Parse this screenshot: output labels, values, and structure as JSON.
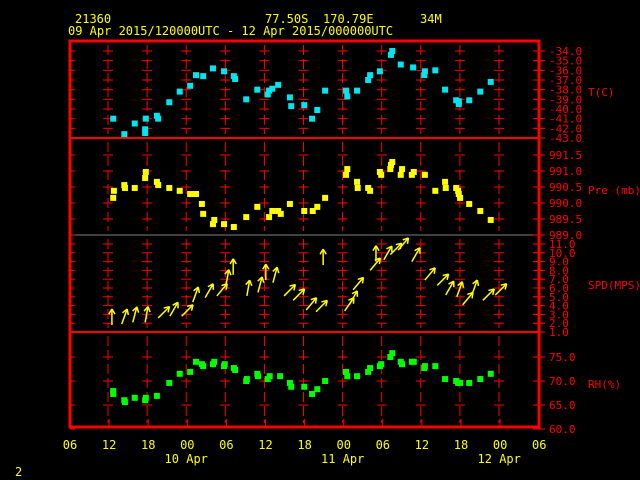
{
  "header": {
    "station": "21360",
    "lat": "77.50S",
    "lon": "170.79E",
    "elev": "34M",
    "period": "09 Apr 2015/120000UTC - 12 Apr 2015/000000UTC"
  },
  "page_number": "2",
  "colors": {
    "frame": "#ff0000",
    "temp": "#00e5ee",
    "pres": "#ffff00",
    "wind": "#ffff00",
    "rh": "#00ff00",
    "text": "#ffff00"
  },
  "chart_data": {
    "type": "scatter",
    "x_unit": "hours since 09 Apr 2015 12 UTC",
    "xlim": [
      -6,
      66
    ],
    "x_tick_labels": [
      "06",
      "12",
      "18",
      "00",
      "06",
      "12",
      "18",
      "00",
      "06",
      "12",
      "18",
      "00",
      "06"
    ],
    "date_labels": [
      {
        "label": "10 Apr",
        "hour": 12
      },
      {
        "label": "11 Apr",
        "hour": 36
      },
      {
        "label": "12 Apr",
        "hour": 60
      }
    ],
    "panels": [
      {
        "key": "temp",
        "label": "T(C)",
        "ylim": [
          -43,
          -34
        ],
        "ticks": [
          "-34.0",
          "-35.0",
          "-36.0",
          "-37.0",
          "-38.0",
          "-39.0",
          "-40.0",
          "-41.0",
          "-42.0",
          "-43.0"
        ],
        "points": [
          [
            0.8,
            -41.0
          ],
          [
            2.5,
            -42.6
          ],
          [
            4.1,
            -41.5
          ],
          [
            5.8,
            -41.0
          ],
          [
            5.7,
            -42.1
          ],
          [
            5.7,
            -42.5
          ],
          [
            7.5,
            -40.7
          ],
          [
            7.7,
            -41.0
          ],
          [
            9.4,
            -39.3
          ],
          [
            11.0,
            -38.2
          ],
          [
            12.6,
            -37.6
          ],
          [
            13.5,
            -36.5
          ],
          [
            14.6,
            -36.6
          ],
          [
            16.1,
            -35.8
          ],
          [
            17.8,
            -36.1
          ],
          [
            19.3,
            -36.6
          ],
          [
            19.5,
            -36.9
          ],
          [
            21.2,
            -39.0
          ],
          [
            22.9,
            -38.0
          ],
          [
            24.5,
            -38.5
          ],
          [
            24.7,
            -38.1
          ],
          [
            25.2,
            -37.9
          ],
          [
            26.1,
            -37.5
          ],
          [
            27.9,
            -38.8
          ],
          [
            28.1,
            -39.7
          ],
          [
            30.1,
            -39.6
          ],
          [
            31.3,
            -41.0
          ],
          [
            32.1,
            -40.1
          ],
          [
            33.3,
            -38.1
          ],
          [
            36.5,
            -38.1
          ],
          [
            36.7,
            -38.7
          ],
          [
            38.2,
            -38.1
          ],
          [
            39.9,
            -37.0
          ],
          [
            40.2,
            -36.5
          ],
          [
            41.7,
            -36.1
          ],
          [
            43.4,
            -34.4
          ],
          [
            43.6,
            -34.0
          ],
          [
            44.9,
            -35.4
          ],
          [
            46.8,
            -35.7
          ],
          [
            48.5,
            -36.5
          ],
          [
            48.6,
            -36.1
          ],
          [
            50.2,
            -36.0
          ],
          [
            51.7,
            -38.0
          ],
          [
            53.4,
            -39.1
          ],
          [
            53.8,
            -39.2
          ],
          [
            53.8,
            -39.5
          ],
          [
            55.4,
            -39.1
          ],
          [
            57.1,
            -38.2
          ],
          [
            58.7,
            -37.2
          ]
        ]
      },
      {
        "key": "pres",
        "label": "Pre (mb)",
        "ylim": [
          989.0,
          991.5
        ],
        "ticks": [
          "991.5",
          "991.0",
          "990.5",
          "990.0",
          "989.5",
          "989.0"
        ],
        "points": [
          [
            0.9,
            990.38
          ],
          [
            0.8,
            990.16
          ],
          [
            2.5,
            990.56
          ],
          [
            2.6,
            990.47
          ],
          [
            4.1,
            990.47
          ],
          [
            5.8,
            990.97
          ],
          [
            5.7,
            990.78
          ],
          [
            7.5,
            990.66
          ],
          [
            7.7,
            990.56
          ],
          [
            9.4,
            990.47
          ],
          [
            11.0,
            990.38
          ],
          [
            12.6,
            990.28
          ],
          [
            13.5,
            990.28
          ],
          [
            14.4,
            989.97
          ],
          [
            14.6,
            989.66
          ],
          [
            16.3,
            989.47
          ],
          [
            16.1,
            989.34
          ],
          [
            17.8,
            989.34
          ],
          [
            19.3,
            989.25
          ],
          [
            21.2,
            989.56
          ],
          [
            22.9,
            989.88
          ],
          [
            24.7,
            989.56
          ],
          [
            25.2,
            989.75
          ],
          [
            26.1,
            989.75
          ],
          [
            26.5,
            989.66
          ],
          [
            27.9,
            989.97
          ],
          [
            30.1,
            989.75
          ],
          [
            31.4,
            989.75
          ],
          [
            32.1,
            989.88
          ],
          [
            33.3,
            990.16
          ],
          [
            36.7,
            991.06
          ],
          [
            36.5,
            990.88
          ],
          [
            38.2,
            990.66
          ],
          [
            38.3,
            990.47
          ],
          [
            39.9,
            990.47
          ],
          [
            40.2,
            990.38
          ],
          [
            41.7,
            990.97
          ],
          [
            41.9,
            990.88
          ],
          [
            43.3,
            991.06
          ],
          [
            43.4,
            991.19
          ],
          [
            43.6,
            991.28
          ],
          [
            45.1,
            991.06
          ],
          [
            44.9,
            990.88
          ],
          [
            46.6,
            990.88
          ],
          [
            46.9,
            990.97
          ],
          [
            48.6,
            990.88
          ],
          [
            50.2,
            990.38
          ],
          [
            51.7,
            990.66
          ],
          [
            51.8,
            990.47
          ],
          [
            53.4,
            990.47
          ],
          [
            53.7,
            990.38
          ],
          [
            53.8,
            990.28
          ],
          [
            54.0,
            990.16
          ],
          [
            55.4,
            989.97
          ],
          [
            57.1,
            989.75
          ],
          [
            58.7,
            989.47
          ]
        ]
      },
      {
        "key": "wind",
        "label": "SPD(MPS)",
        "ylim": [
          1,
          11
        ],
        "ticks": [
          "11.0",
          "10.0",
          "9.0",
          "8.0",
          "7.0",
          "6.0",
          "5.0",
          "4.0",
          "3.0",
          "2.0",
          "1.0"
        ],
        "points": [
          [
            0.6,
            1.8,
            0
          ],
          [
            2.1,
            1.9,
            20
          ],
          [
            3.8,
            2.1,
            15
          ],
          [
            5.7,
            2.1,
            10
          ],
          [
            7.7,
            2.6,
            45
          ],
          [
            9.5,
            2.8,
            30
          ],
          [
            11.3,
            2.8,
            45
          ],
          [
            13.0,
            4.4,
            20
          ],
          [
            14.9,
            4.9,
            30
          ],
          [
            16.7,
            5.1,
            40
          ],
          [
            18.1,
            6.3,
            10
          ],
          [
            19.2,
            7.5,
            0
          ],
          [
            21.3,
            5.1,
            10
          ],
          [
            23.0,
            5.5,
            15
          ],
          [
            24.2,
            6.9,
            0
          ],
          [
            25.3,
            6.6,
            15
          ],
          [
            27.0,
            5.1,
            45
          ],
          [
            28.4,
            4.6,
            45
          ],
          [
            30.4,
            3.5,
            40
          ],
          [
            31.9,
            3.3,
            45
          ],
          [
            33.0,
            8.6,
            0
          ],
          [
            36.3,
            3.4,
            35
          ],
          [
            37.0,
            4.1,
            30
          ],
          [
            37.6,
            5.8,
            40
          ],
          [
            40.2,
            8.0,
            40
          ],
          [
            41.1,
            9.0,
            0
          ],
          [
            42.3,
            9.2,
            30
          ],
          [
            43.3,
            9.8,
            45
          ],
          [
            44.5,
            10.3,
            40
          ],
          [
            46.6,
            9.0,
            30
          ],
          [
            48.6,
            6.9,
            40
          ],
          [
            50.5,
            6.3,
            45
          ],
          [
            51.8,
            5.2,
            30
          ],
          [
            53.5,
            5.0,
            20
          ],
          [
            54.4,
            4.1,
            40
          ],
          [
            55.8,
            5.2,
            20
          ],
          [
            57.5,
            4.6,
            45
          ],
          [
            59.4,
            5.2,
            45
          ]
        ]
      },
      {
        "key": "rh",
        "label": "RH(%)",
        "ylim": [
          60,
          75
        ],
        "ticks": [
          "75.0",
          "70.0",
          "65.0",
          "60.0"
        ],
        "points": [
          [
            0.8,
            67.9
          ],
          [
            0.8,
            67.3
          ],
          [
            2.5,
            66.0
          ],
          [
            2.6,
            65.6
          ],
          [
            4.1,
            66.5
          ],
          [
            5.8,
            66.5
          ],
          [
            5.7,
            66.0
          ],
          [
            7.5,
            66.9
          ],
          [
            9.4,
            69.6
          ],
          [
            11.0,
            71.5
          ],
          [
            12.6,
            71.9
          ],
          [
            13.5,
            74.0
          ],
          [
            14.4,
            73.5
          ],
          [
            14.6,
            73.1
          ],
          [
            16.1,
            73.5
          ],
          [
            16.3,
            74.0
          ],
          [
            17.8,
            73.1
          ],
          [
            17.9,
            73.5
          ],
          [
            19.3,
            72.7
          ],
          [
            19.5,
            72.3
          ],
          [
            21.2,
            70.0
          ],
          [
            21.3,
            70.4
          ],
          [
            22.9,
            71.5
          ],
          [
            23.0,
            71.0
          ],
          [
            24.5,
            70.4
          ],
          [
            24.8,
            71.0
          ],
          [
            26.4,
            71.0
          ],
          [
            27.9,
            69.6
          ],
          [
            28.1,
            68.8
          ],
          [
            30.1,
            68.8
          ],
          [
            31.3,
            67.3
          ],
          [
            32.1,
            68.3
          ],
          [
            33.3,
            70.0
          ],
          [
            36.5,
            71.9
          ],
          [
            36.7,
            71.0
          ],
          [
            38.2,
            71.0
          ],
          [
            39.9,
            71.9
          ],
          [
            40.2,
            72.7
          ],
          [
            41.7,
            73.1
          ],
          [
            41.9,
            73.5
          ],
          [
            43.3,
            75.0
          ],
          [
            43.6,
            75.8
          ],
          [
            44.9,
            74.0
          ],
          [
            45.1,
            73.5
          ],
          [
            46.6,
            74.0
          ],
          [
            46.9,
            74.0
          ],
          [
            48.5,
            72.7
          ],
          [
            48.6,
            73.1
          ],
          [
            50.2,
            73.1
          ],
          [
            51.7,
            70.4
          ],
          [
            53.4,
            70.0
          ],
          [
            53.7,
            69.6
          ],
          [
            54.0,
            69.6
          ],
          [
            55.4,
            69.6
          ],
          [
            57.1,
            70.4
          ],
          [
            58.7,
            71.5
          ]
        ]
      }
    ]
  }
}
